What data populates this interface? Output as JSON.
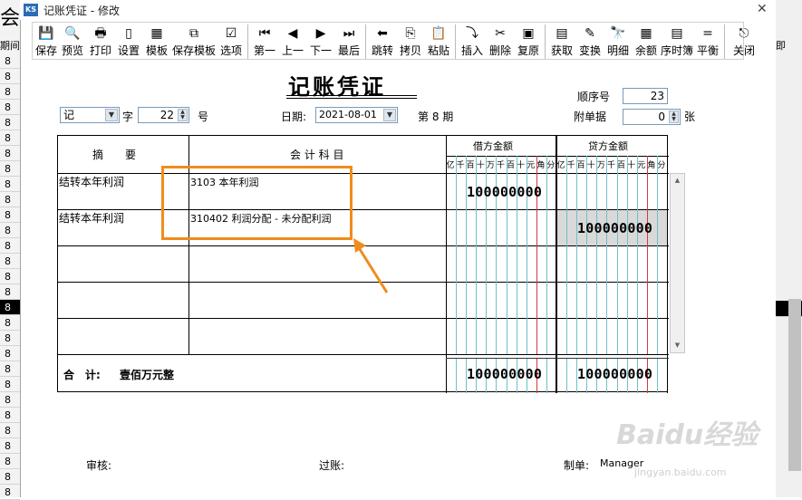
{
  "background_app": {
    "big_char": "会",
    "col_header": "期间",
    "period_values": [
      "8",
      "8",
      "8",
      "8",
      "8",
      "8",
      "8",
      "8",
      "8",
      "8",
      "8",
      "8",
      "8",
      "8",
      "8",
      "8",
      "8",
      "8",
      "8",
      "8",
      "8",
      "8",
      "8",
      "8",
      "8",
      "8",
      "8",
      "8",
      "8"
    ],
    "right_header": "即"
  },
  "window": {
    "title": "记账凭证 - 修改",
    "icon": "ks-app-icon"
  },
  "toolbar": [
    {
      "label": "保存",
      "icon": "save-icon",
      "glyph": "💾"
    },
    {
      "label": "预览",
      "icon": "preview-icon",
      "glyph": "🔍"
    },
    {
      "label": "打印",
      "icon": "print-icon",
      "glyph": "🖶"
    },
    {
      "label": "设置",
      "icon": "page-setup-icon",
      "glyph": "▯"
    },
    {
      "label": "模板",
      "icon": "template-icon",
      "glyph": "▦"
    },
    {
      "label": "保存模板",
      "icon": "save-template-icon",
      "glyph": "⧉"
    },
    {
      "label": "选项",
      "icon": "options-icon",
      "glyph": "☑"
    },
    {
      "label": "第一",
      "icon": "first-icon",
      "glyph": "⏮"
    },
    {
      "label": "上一",
      "icon": "prev-icon",
      "glyph": "◀"
    },
    {
      "label": "下一",
      "icon": "next-icon",
      "glyph": "▶"
    },
    {
      "label": "最后",
      "icon": "last-icon",
      "glyph": "⏭"
    },
    {
      "label": "跳转",
      "icon": "jump-icon",
      "glyph": "⬅"
    },
    {
      "label": "拷贝",
      "icon": "copy-icon",
      "glyph": "⎘"
    },
    {
      "label": "粘贴",
      "icon": "paste-icon",
      "glyph": "📋"
    },
    {
      "label": "插入",
      "icon": "insert-icon",
      "glyph": "⤵"
    },
    {
      "label": "删除",
      "icon": "delete-icon",
      "glyph": "✂"
    },
    {
      "label": "复原",
      "icon": "restore-icon",
      "glyph": "▣"
    },
    {
      "label": "获取",
      "icon": "fetch-icon",
      "glyph": "▤"
    },
    {
      "label": "变换",
      "icon": "transform-icon",
      "glyph": "✎"
    },
    {
      "label": "明细",
      "icon": "detail-icon",
      "glyph": "🔭"
    },
    {
      "label": "余额",
      "icon": "balance-icon",
      "glyph": "▦"
    },
    {
      "label": "序时簿",
      "icon": "journal-icon",
      "glyph": "▤"
    },
    {
      "label": "平衡",
      "icon": "equal-icon",
      "glyph": "="
    },
    {
      "label": "关闭",
      "icon": "close-door-icon",
      "glyph": "⎋"
    }
  ],
  "voucher": {
    "title": "记账凭证",
    "seq_label": "顺序号",
    "seq_value": "23",
    "type_value": "记",
    "zi_label": "字",
    "number_value": "22",
    "hao_label": "号",
    "date_label": "日期:",
    "date_value": "2021-08-01",
    "period_text": "第 8 期",
    "attach_label": "附单据",
    "attach_value": "0",
    "zhang_label": "张",
    "header_summary": "摘　　要",
    "header_account": "会 计 科 目",
    "header_debit": "借方金额",
    "header_credit": "贷方金额",
    "digit_units": [
      "亿",
      "千",
      "百",
      "十",
      "万",
      "千",
      "百",
      "十",
      "元",
      "角",
      "分"
    ],
    "rows": [
      {
        "summary": "结转本年利润",
        "account": "3103 本年利润",
        "debit": "100000000",
        "credit": ""
      },
      {
        "summary": "结转本年利润",
        "account": "310402 利润分配 - 未分配利润",
        "debit": "",
        "credit": "100000000"
      }
    ],
    "total_label": "合　计:",
    "total_words": "壹佰万元整",
    "total_debit": "100000000",
    "total_credit": "100000000",
    "audit_label": "审核:",
    "post_label": "过账:",
    "maker_label": "制单:",
    "maker_value": "Manager"
  },
  "watermark": {
    "text": "Baidu经验",
    "sub": "jingyan.baidu.com"
  },
  "colors": {
    "highlight": "#f08c1c",
    "credit_cell_bg": "#d9d9d9",
    "digit_line": "#6fc0c6",
    "yuan_line": "#d23b3b"
  }
}
